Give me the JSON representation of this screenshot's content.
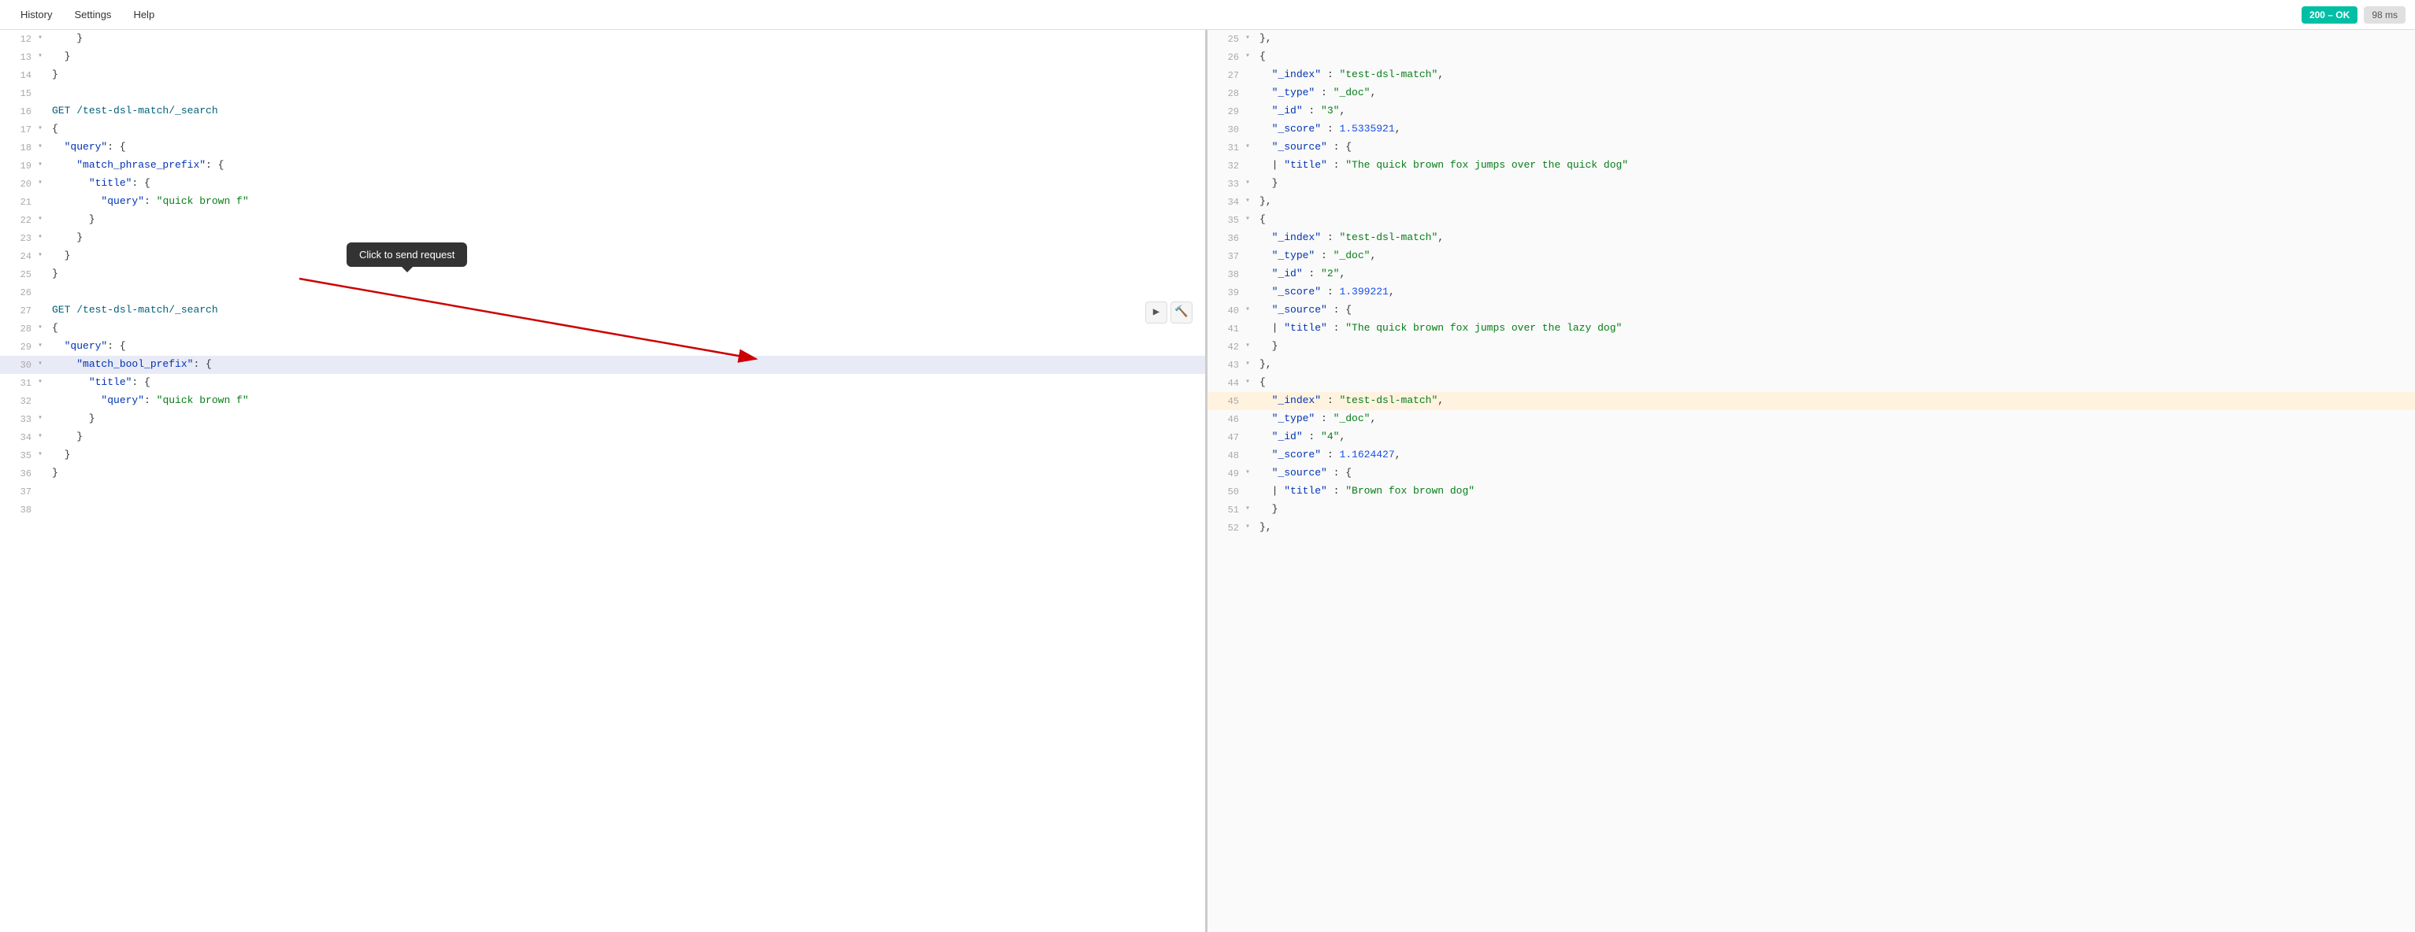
{
  "menu": {
    "items": [
      "History",
      "Settings",
      "Help"
    ]
  },
  "status": {
    "ok_label": "200 – OK",
    "time_label": "98 ms"
  },
  "tooltip": {
    "text": "Click to send request"
  },
  "editor": {
    "lines": [
      {
        "num": 12,
        "indent": 4,
        "fold": "▾",
        "content": "    }"
      },
      {
        "num": 13,
        "indent": 2,
        "fold": "▾",
        "content": "  }"
      },
      {
        "num": 14,
        "indent": 0,
        "fold": "",
        "content": "}"
      },
      {
        "num": 15,
        "indent": 0,
        "fold": "",
        "content": ""
      },
      {
        "num": 16,
        "indent": 0,
        "fold": "",
        "content": "GET /test-dsl-match/_search",
        "type": "method"
      },
      {
        "num": 17,
        "indent": 0,
        "fold": "▾",
        "content": "{"
      },
      {
        "num": 18,
        "indent": 2,
        "fold": "▾",
        "content": "  \"query\": {"
      },
      {
        "num": 19,
        "indent": 4,
        "fold": "▾",
        "content": "    \"match_phrase_prefix\": {"
      },
      {
        "num": 20,
        "indent": 6,
        "fold": "▾",
        "content": "      \"title\": {"
      },
      {
        "num": 21,
        "indent": 8,
        "fold": "",
        "content": "        \"query\": \"quick brown f\""
      },
      {
        "num": 22,
        "indent": 6,
        "fold": "▾",
        "content": "      }"
      },
      {
        "num": 23,
        "indent": 4,
        "fold": "▾",
        "content": "    }"
      },
      {
        "num": 24,
        "indent": 2,
        "fold": "▾",
        "content": "  }"
      },
      {
        "num": 25,
        "indent": 0,
        "fold": "",
        "content": "}"
      },
      {
        "num": 26,
        "indent": 0,
        "fold": "",
        "content": ""
      },
      {
        "num": 27,
        "indent": 0,
        "fold": "",
        "content": "GET /test-dsl-match/_search",
        "type": "method",
        "highlight": false
      },
      {
        "num": 28,
        "indent": 0,
        "fold": "▾",
        "content": "{"
      },
      {
        "num": 29,
        "indent": 2,
        "fold": "▾",
        "content": "  \"query\": {"
      },
      {
        "num": 30,
        "indent": 4,
        "fold": "▾",
        "content": "    \"match_bool_prefix\": {",
        "highlight": true
      },
      {
        "num": 31,
        "indent": 6,
        "fold": "▾",
        "content": "      \"title\": {"
      },
      {
        "num": 32,
        "indent": 8,
        "fold": "",
        "content": "        \"query\": \"quick brown f\""
      },
      {
        "num": 33,
        "indent": 6,
        "fold": "▾",
        "content": "      }"
      },
      {
        "num": 34,
        "indent": 4,
        "fold": "▾",
        "content": "    }"
      },
      {
        "num": 35,
        "indent": 2,
        "fold": "▾",
        "content": "  }"
      },
      {
        "num": 36,
        "indent": 0,
        "fold": "",
        "content": "}"
      },
      {
        "num": 37,
        "indent": 0,
        "fold": "",
        "content": ""
      },
      {
        "num": 38,
        "indent": 0,
        "fold": "",
        "content": ""
      }
    ]
  },
  "response": {
    "lines": [
      {
        "num": 25,
        "fold": "▾",
        "content": "},"
      },
      {
        "num": 26,
        "fold": "▾",
        "content": "{"
      },
      {
        "num": 27,
        "fold": "",
        "content": "  \"_index\" : \"test-dsl-match\",",
        "type": "kv"
      },
      {
        "num": 28,
        "fold": "",
        "content": "  \"_type\" : \"_doc\",",
        "type": "kv"
      },
      {
        "num": 29,
        "fold": "",
        "content": "  \"_id\" : \"3\",",
        "type": "kv"
      },
      {
        "num": 30,
        "fold": "",
        "content": "  \"_score\" : 1.5335921,",
        "type": "kv"
      },
      {
        "num": 31,
        "fold": "▾",
        "content": "  \"_source\" : {"
      },
      {
        "num": 32,
        "fold": "",
        "content": "  | \"title\" : \"The quick brown fox jumps over the quick dog\""
      },
      {
        "num": 33,
        "fold": "▾",
        "content": "  }"
      },
      {
        "num": 34,
        "fold": "▾",
        "content": "},"
      },
      {
        "num": 35,
        "fold": "▾",
        "content": "{"
      },
      {
        "num": 36,
        "fold": "",
        "content": "  \"_index\" : \"test-dsl-match\",",
        "type": "kv"
      },
      {
        "num": 37,
        "fold": "",
        "content": "  \"_type\" : \"_doc\",",
        "type": "kv"
      },
      {
        "num": 38,
        "fold": "",
        "content": "  \"_id\" : \"2\",",
        "type": "kv"
      },
      {
        "num": 39,
        "fold": "",
        "content": "  \"_score\" : 1.399221,",
        "type": "kv"
      },
      {
        "num": 40,
        "fold": "▾",
        "content": "  \"_source\" : {"
      },
      {
        "num": 41,
        "fold": "",
        "content": "  | \"title\" : \"The quick brown fox jumps over the lazy dog\""
      },
      {
        "num": 42,
        "fold": "▾",
        "content": "  }"
      },
      {
        "num": 43,
        "fold": "▾",
        "content": "},"
      },
      {
        "num": 44,
        "fold": "▾",
        "content": "{"
      },
      {
        "num": 45,
        "fold": "",
        "content": "  \"_index\" : \"test-dsl-match\",",
        "type": "kv",
        "highlight": true
      },
      {
        "num": 46,
        "fold": "",
        "content": "  \"_type\" : \"_doc\",",
        "type": "kv"
      },
      {
        "num": 47,
        "fold": "",
        "content": "  \"_id\" : \"4\",",
        "type": "kv"
      },
      {
        "num": 48,
        "fold": "",
        "content": "  \"_score\" : 1.1624427,",
        "type": "kv"
      },
      {
        "num": 49,
        "fold": "▾",
        "content": "  \"_source\" : {"
      },
      {
        "num": 50,
        "fold": "",
        "content": "  | \"title\" : \"Brown fox brown dog\""
      },
      {
        "num": 51,
        "fold": "▾",
        "content": "  }"
      },
      {
        "num": 52,
        "fold": "▾",
        "content": "},"
      }
    ]
  }
}
